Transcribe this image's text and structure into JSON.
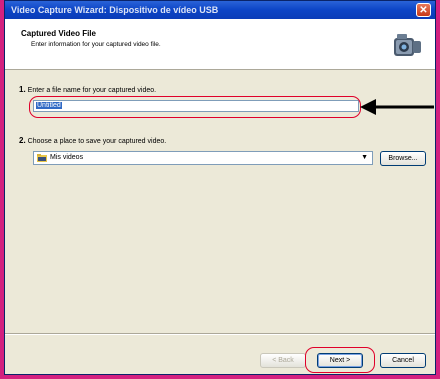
{
  "window": {
    "title": "Video Capture Wizard: Dispositivo de vídeo USB",
    "close_glyph": "✕"
  },
  "header": {
    "title": "Captured Video File",
    "subtitle": "Enter information for your captured video file."
  },
  "step1": {
    "number": "1.",
    "label": "Enter a file name for your captured video.",
    "value": "Untitled"
  },
  "step2": {
    "number": "2.",
    "label": "Choose a place to save your captured video.",
    "folder": "Mis videos",
    "browse_label": "Browse..."
  },
  "footer": {
    "back_label": "< Back",
    "next_label": "Next >",
    "cancel_label": "Cancel"
  },
  "colors": {
    "annotation": "#e0002a",
    "titlebar": "#0c44c6",
    "selection": "#316ac5"
  }
}
